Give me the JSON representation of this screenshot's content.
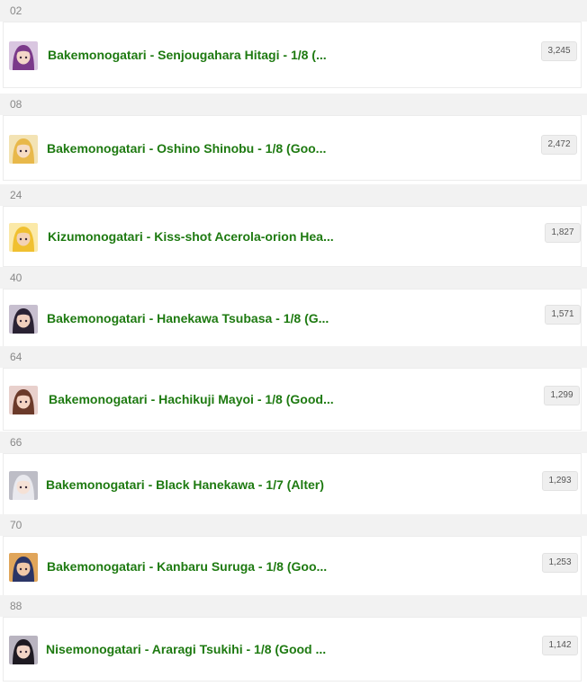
{
  "entries": [
    {
      "rank": "02",
      "title": "Bakemonogatari - Senjougahara Hitagi - 1/8 (...",
      "count": "3,245",
      "thumb_icon": "figure-thumbnail-purple-hair",
      "hair": "#7b3a8a",
      "skin": "#f3d6c8",
      "bg": "#d9c6e0"
    },
    {
      "rank": "08",
      "title": "Bakemonogatari - Oshino Shinobu - 1/8 (Goo...",
      "count": "2,472",
      "thumb_icon": "figure-thumbnail-blonde-hair",
      "hair": "#e8b84a",
      "skin": "#f6dcc4",
      "bg": "#f3e3b4"
    },
    {
      "rank": "24",
      "title": "Kizumonogatari - Kiss-shot Acerola-orion Hea...",
      "count": "1,827",
      "thumb_icon": "figure-thumbnail-blonde-hair",
      "hair": "#f0c030",
      "skin": "#f3d2b4",
      "bg": "#fbe9a8"
    },
    {
      "rank": "40",
      "title": "Bakemonogatari - Hanekawa Tsubasa - 1/8 (G...",
      "count": "1,571",
      "thumb_icon": "figure-thumbnail-dark-hair",
      "hair": "#2a2233",
      "skin": "#f1cfbd",
      "bg": "#c7bfcf"
    },
    {
      "rank": "64",
      "title": "Bakemonogatari - Hachikuji Mayoi - 1/8 (Good...",
      "count": "1,299",
      "thumb_icon": "figure-thumbnail-brown-hair",
      "hair": "#6b3a2a",
      "skin": "#f4d3c2",
      "bg": "#e8d0cc"
    },
    {
      "rank": "66",
      "title": "Bakemonogatari - Black Hanekawa - 1/7 (Alter)",
      "count": "1,293",
      "thumb_icon": "figure-thumbnail-white-hair",
      "hair": "#e9e9ee",
      "skin": "#f5e1d6",
      "bg": "#bdbdc6"
    },
    {
      "rank": "70",
      "title": "Bakemonogatari - Kanbaru Suruga - 1/8 (Goo...",
      "count": "1,253",
      "thumb_icon": "figure-thumbnail-dark-blue-hair",
      "hair": "#2b3566",
      "skin": "#f0c8a8",
      "bg": "#e0a55a"
    },
    {
      "rank": "88",
      "title": "Nisemonogatari - Araragi Tsukihi - 1/8 (Good ...",
      "count": "1,142",
      "thumb_icon": "figure-thumbnail-black-hair",
      "hair": "#1e1a22",
      "skin": "#f1d4c6",
      "bg": "#b9b4c0"
    }
  ]
}
